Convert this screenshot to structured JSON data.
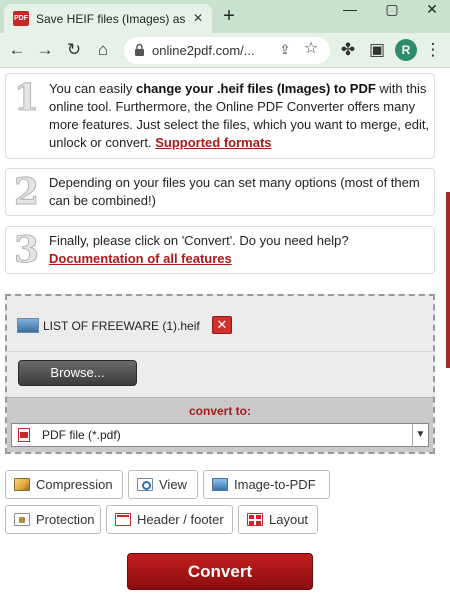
{
  "browser": {
    "tab_title": "Save HEIF files (Images) as PDF",
    "tab_favicon_text": "PDF",
    "new_tab_symbol": "+",
    "url": "online2pdf.com/...",
    "profile_initial": "R",
    "window_controls": {
      "minimize": "—",
      "maximize": "▢",
      "close": "✕"
    }
  },
  "steps": [
    {
      "number": "1",
      "text_before": "You can easily ",
      "text_bold": "change your .heif files (Images) to PDF",
      "text_after": " with this online tool. Furthermore, the Online PDF Converter offers many more features. Just select the files, which you want to merge, edit, unlock or convert. ",
      "link": "Supported formats"
    },
    {
      "number": "2",
      "text": "Depending on your files you can set many options (most of them can be combined!)"
    },
    {
      "number": "3",
      "text": "Finally, please click on 'Convert'. Do you need help?",
      "link": "Documentation of all features"
    }
  ],
  "upload": {
    "file_name": "LIST OF FREEWARE (1).heif",
    "remove_symbol": "✕",
    "browse_label": "Browse...",
    "convert_to_label": "convert to:",
    "format_selected": "PDF file (*.pdf)"
  },
  "options": [
    {
      "label": "Compression",
      "icon": "compression-icon"
    },
    {
      "label": "View",
      "icon": "view-icon"
    },
    {
      "label": "Image-to-PDF",
      "icon": "image-icon"
    },
    {
      "label": "Protection",
      "icon": "lock-icon"
    },
    {
      "label": "Header / footer",
      "icon": "header-footer-icon"
    },
    {
      "label": "Layout",
      "icon": "layout-icon"
    }
  ],
  "convert_label": "Convert",
  "colors": {
    "tab_bar": "#c9e2cd",
    "accent_red": "#b01818",
    "convert_button": "#a81616"
  }
}
